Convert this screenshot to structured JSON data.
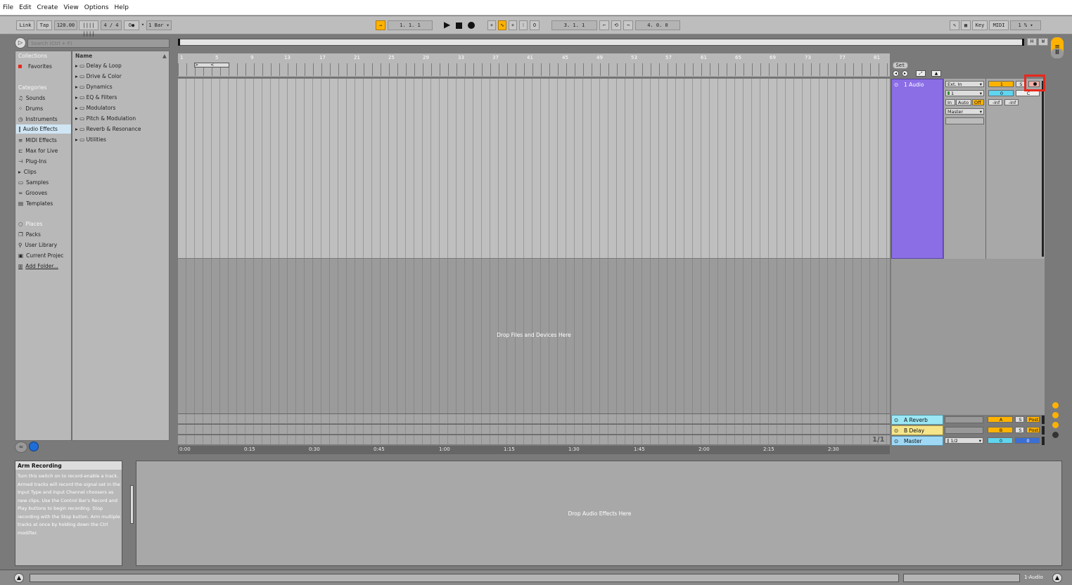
{
  "menu": [
    "File",
    "Edit",
    "Create",
    "View",
    "Options",
    "Help"
  ],
  "control_bar": {
    "link": "Link",
    "tap": "Tap",
    "tempo": "120.00",
    "nudge": "|||| ||||",
    "time_sig": "4 / 4",
    "metronome": "O●",
    "quantize": "1 Bar",
    "position": "1.  1.  1",
    "loop_start": "3.  1.  1",
    "loop_length": "4.  0.  0",
    "key": "Key",
    "midi": "MIDI",
    "cpu": "1 %"
  },
  "browser": {
    "search_placeholder": "Search (Ctrl + F)",
    "collections_header": "Collections",
    "favorites": "Favorites",
    "categories_header": "Categories",
    "categories": [
      "Sounds",
      "Drums",
      "Instruments",
      "Audio Effects",
      "MIDI Effects",
      "Max for Live",
      "Plug-Ins",
      "Clips",
      "Samples",
      "Grooves",
      "Templates"
    ],
    "places_header": "Places",
    "places": [
      "Packs",
      "User Library",
      "Current Projec",
      "Add Folder..."
    ],
    "name_header": "Name",
    "folders": [
      "Delay & Loop",
      "Drive & Color",
      "Dynamics",
      "EQ & Filters",
      "Modulators",
      "Pitch & Modulation",
      "Reverb & Resonance",
      "Utilities"
    ]
  },
  "arrangement": {
    "overview_h": "H",
    "overview_w": "W",
    "bar_numbers": [
      "1",
      "5",
      "9",
      "13",
      "17",
      "21",
      "25",
      "29",
      "33",
      "37",
      "41",
      "45",
      "49",
      "53",
      "57",
      "61",
      "65",
      "69",
      "73",
      "77",
      "81"
    ],
    "set_label": "Set",
    "drop_files": "Drop Files and Devices Here",
    "time_ticks": [
      "0:00",
      "0:15",
      "0:30",
      "0:45",
      "1:00",
      "1:15",
      "1:30",
      "1:45",
      "2:00",
      "2:15",
      "2:30"
    ],
    "page": "1/1"
  },
  "tracks": {
    "audio": {
      "name": "1 Audio",
      "input_type": "Ext. In",
      "input_channel": "1",
      "in": "In",
      "auto": "Auto",
      "off": "Off",
      "output": "Master",
      "number": "1",
      "solo": "S",
      "volume": "0",
      "pan": "C",
      "peak_l": "-inf",
      "peak_r": "-inf"
    },
    "returns": [
      {
        "name": "A Reverb",
        "letter": "A",
        "solo": "S",
        "post": "Post"
      },
      {
        "name": "B Delay",
        "letter": "B",
        "solo": "S",
        "post": "Post"
      }
    ],
    "master": {
      "name": "Master",
      "output": "1/2",
      "volume": "0",
      "pan": "0"
    }
  },
  "info_view": {
    "title": "Arm Recording",
    "text": "Turn this switch on to record-enable a track. Armed tracks will record the signal set in the Input Type and Input Channel choosers as new clips. Use the Control Bar's Record and Play buttons to begin recording. Stop recording with the Stop button. Arm multiple tracks at once by holding down the Ctrl modifier."
  },
  "device_view": {
    "drop_label": "Drop Audio Effects Here"
  },
  "status": {
    "track": "1-Audio"
  },
  "colors": {
    "audio_track": "#8b6ee6",
    "accent": "#ffb300",
    "return_a": "#9be7f5",
    "return_b": "#f5e48a",
    "master": "#9fd8f5",
    "highlight": "#e8281c"
  }
}
